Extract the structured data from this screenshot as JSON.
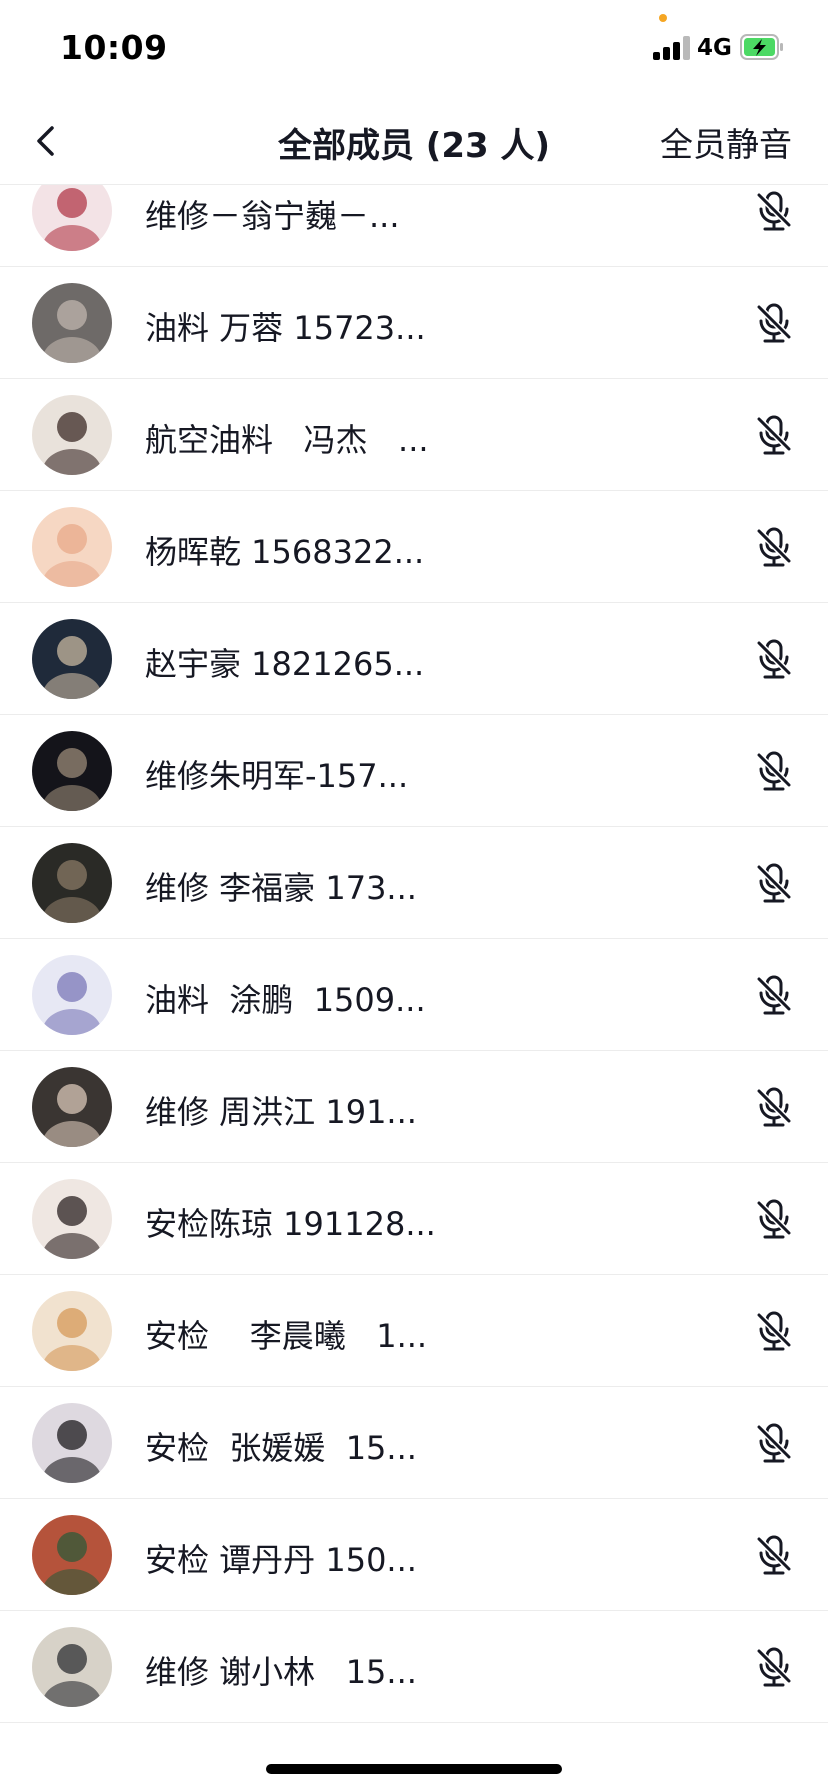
{
  "status_bar": {
    "time": "10:09",
    "network": "4G",
    "battery_state": "charging",
    "colors": {
      "battery_fill": "#4cd964",
      "privacy_dot": "#f5a623"
    }
  },
  "nav": {
    "back_icon": "chevron-left-icon",
    "title": "全部成员 (23 人)",
    "mute_all_label": "全员静音"
  },
  "members": [
    {
      "name": "维修－翁宁巍－...",
      "avatar_colors": [
        "#f3e3e6",
        "#b23a4a"
      ]
    },
    {
      "name": "油料 万蓉 15723...",
      "avatar_colors": [
        "#6e6a68",
        "#c0b5ad"
      ]
    },
    {
      "name": "航空油料   冯杰   ...",
      "avatar_colors": [
        "#e9e2db",
        "#3b2a26"
      ]
    },
    {
      "name": "杨晖乾 1568322...",
      "avatar_colors": [
        "#f6d7c3",
        "#e8a98a"
      ]
    },
    {
      "name": "赵宇豪 1821265...",
      "avatar_colors": [
        "#1f2a3a",
        "#c8b8a0"
      ]
    },
    {
      "name": "维修朱明军-157...",
      "avatar_colors": [
        "#14141a",
        "#9a8a78"
      ]
    },
    {
      "name": "维修 李福豪 173...",
      "avatar_colors": [
        "#2a2a26",
        "#8a7a66"
      ]
    },
    {
      "name": "油料  涂鹏  1509...",
      "avatar_colors": [
        "#e7e8f4",
        "#7b78b8"
      ]
    },
    {
      "name": "维修 周洪江 191...",
      "avatar_colors": [
        "#3a3532",
        "#d9c7b8"
      ]
    },
    {
      "name": "安检陈琼 191128...",
      "avatar_colors": [
        "#efe7e2",
        "#2b2222"
      ]
    },
    {
      "name": "安检    李晨曦   1...",
      "avatar_colors": [
        "#f1e2cf",
        "#d59a5a"
      ]
    },
    {
      "name": "安检  张媛媛  15...",
      "avatar_colors": [
        "#ded9e0",
        "#1c1a1e"
      ]
    },
    {
      "name": "安检 谭丹丹 150...",
      "avatar_colors": [
        "#b5533b",
        "#2f5a3a"
      ]
    },
    {
      "name": "维修 谢小林   15...",
      "avatar_colors": [
        "#d7d2c8",
        "#2d2f33"
      ]
    },
    {
      "name": "",
      "avatar_colors": [
        "#e5e5e5",
        "#bbbbbb"
      ]
    }
  ],
  "row_icon": "mic-muted-icon"
}
